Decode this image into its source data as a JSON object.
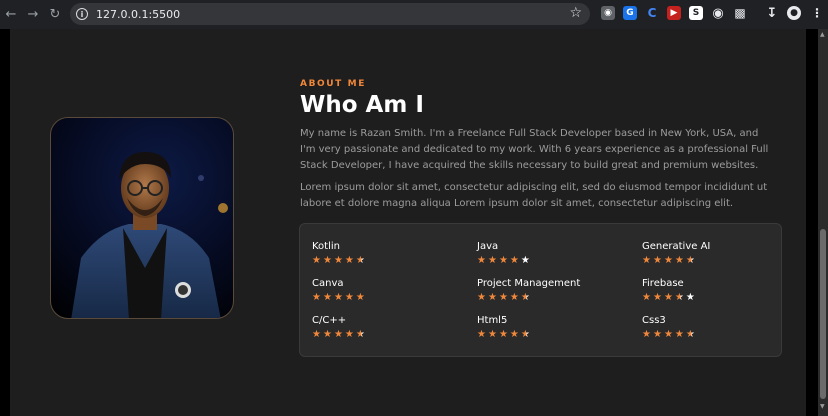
{
  "browser": {
    "url": "127.0.0.1:5500"
  },
  "about": {
    "eyebrow": "ABOUT ME",
    "title": "Who Am I",
    "paragraph1": "My name is Razan Smith. I'm a Freelance Full Stack Developer based in New York, USA, and I'm very passionate and dedicated to my work. With 6 years experience as a professional Full Stack Developer, I have acquired the skills necessary to build great and premium websites.",
    "paragraph2": "Lorem ipsum dolor sit amet, consectetur adipiscing elit, sed do eiusmod tempor incididunt ut labore et dolore magna aliqua Lorem ipsum dolor sit amet, consectetur adipiscing elit."
  },
  "skills": [
    {
      "name": "Kotlin",
      "rating": 4.5
    },
    {
      "name": "Java",
      "rating": 4
    },
    {
      "name": "Generative AI",
      "rating": 4.5
    },
    {
      "name": "Canva",
      "rating": 5
    },
    {
      "name": "Project Management",
      "rating": 4.5
    },
    {
      "name": "Firebase",
      "rating": 3.5
    },
    {
      "name": "C/C++",
      "rating": 4.5
    },
    {
      "name": "Html5",
      "rating": 4.5
    },
    {
      "name": "Css3",
      "rating": 4.5
    }
  ],
  "colors": {
    "accent": "#f0873a",
    "background": "#1e1e1e",
    "card": "#2a2a2a"
  },
  "icons": [
    "back-arrow-icon",
    "forward-arrow-icon",
    "reload-icon",
    "info-icon",
    "bookmark-star-icon",
    "download-icon",
    "profile-icon"
  ]
}
